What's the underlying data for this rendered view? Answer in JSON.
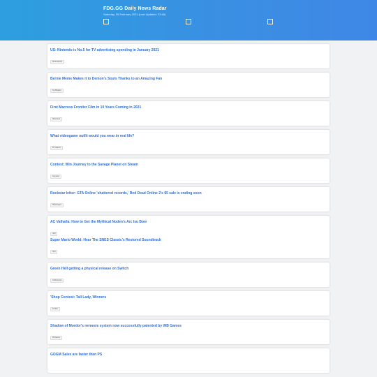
{
  "header": {
    "title": "FDG.GG Daily News Radar",
    "subtitle": "Saturday, 06 February 2021 (Last Updated: 23:45)"
  },
  "items": [
    {
      "title": "US: Nintendo is No.5 for TV advertising spending in January 2021",
      "source": "NintendoLife"
    },
    {
      "title": "Bernie Meme Makes it to Demon's Souls Thanks to an Amazing Fan",
      "source": "TechRaptor"
    },
    {
      "title": "First Macross Frontier Film in 10 Years Coming in 2021",
      "source": "Siliconera"
    },
    {
      "title": "What videogame outfit would you wear in real life?",
      "source": "PC Gamer"
    },
    {
      "title": "Contest: Win Journey to the Savage Planet on Steam",
      "source": "Gematsu"
    },
    {
      "title": "Rockstar letter: GTA Online 'shattered records,' Red Dead Online 2's $5 sale is ending soon",
      "source": "Shacknews"
    },
    {
      "title": "AC Valhalla: How to Get the Mythical Noden's Arc Isu Bow",
      "source": "IGN"
    },
    {
      "title": "Super Mario World: Hear The SNES Classic's Restored Soundtrack",
      "source": "IGN"
    },
    {
      "title": "Green Hell getting a physical release on Switch",
      "source": "GoNintendo"
    },
    {
      "title": "'Shop Contest: Tall Lady, Winners",
      "source": "Kotaku"
    },
    {
      "title": "Shadow of Mordor's nemesis system now successfully patented by WB Games",
      "source": "PCGamer"
    },
    {
      "title": "GOGM Sales are faster than PS",
      "source": ""
    }
  ]
}
